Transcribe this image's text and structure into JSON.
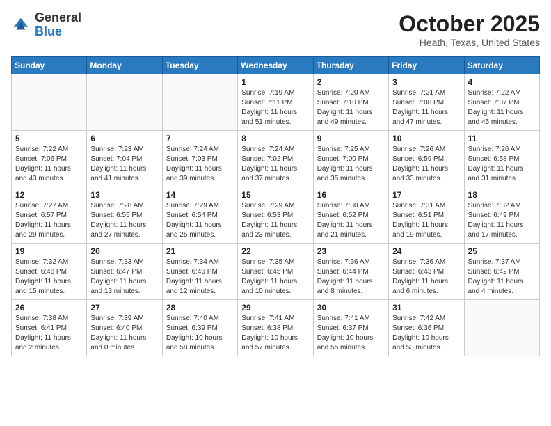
{
  "header": {
    "logo_general": "General",
    "logo_blue": "Blue",
    "month": "October 2025",
    "location": "Heath, Texas, United States"
  },
  "weekdays": [
    "Sunday",
    "Monday",
    "Tuesday",
    "Wednesday",
    "Thursday",
    "Friday",
    "Saturday"
  ],
  "weeks": [
    [
      {
        "day": "",
        "empty": true
      },
      {
        "day": "",
        "empty": true
      },
      {
        "day": "",
        "empty": true
      },
      {
        "day": "1",
        "rise": "7:19 AM",
        "set": "7:11 PM",
        "daylight": "11 hours and 51 minutes."
      },
      {
        "day": "2",
        "rise": "7:20 AM",
        "set": "7:10 PM",
        "daylight": "11 hours and 49 minutes."
      },
      {
        "day": "3",
        "rise": "7:21 AM",
        "set": "7:08 PM",
        "daylight": "11 hours and 47 minutes."
      },
      {
        "day": "4",
        "rise": "7:22 AM",
        "set": "7:07 PM",
        "daylight": "11 hours and 45 minutes."
      }
    ],
    [
      {
        "day": "5",
        "rise": "7:22 AM",
        "set": "7:06 PM",
        "daylight": "11 hours and 43 minutes."
      },
      {
        "day": "6",
        "rise": "7:23 AM",
        "set": "7:04 PM",
        "daylight": "11 hours and 41 minutes."
      },
      {
        "day": "7",
        "rise": "7:24 AM",
        "set": "7:03 PM",
        "daylight": "11 hours and 39 minutes."
      },
      {
        "day": "8",
        "rise": "7:24 AM",
        "set": "7:02 PM",
        "daylight": "11 hours and 37 minutes."
      },
      {
        "day": "9",
        "rise": "7:25 AM",
        "set": "7:00 PM",
        "daylight": "11 hours and 35 minutes."
      },
      {
        "day": "10",
        "rise": "7:26 AM",
        "set": "6:59 PM",
        "daylight": "11 hours and 33 minutes."
      },
      {
        "day": "11",
        "rise": "7:26 AM",
        "set": "6:58 PM",
        "daylight": "11 hours and 31 minutes."
      }
    ],
    [
      {
        "day": "12",
        "rise": "7:27 AM",
        "set": "6:57 PM",
        "daylight": "11 hours and 29 minutes."
      },
      {
        "day": "13",
        "rise": "7:28 AM",
        "set": "6:55 PM",
        "daylight": "11 hours and 27 minutes."
      },
      {
        "day": "14",
        "rise": "7:29 AM",
        "set": "6:54 PM",
        "daylight": "11 hours and 25 minutes."
      },
      {
        "day": "15",
        "rise": "7:29 AM",
        "set": "6:53 PM",
        "daylight": "11 hours and 23 minutes."
      },
      {
        "day": "16",
        "rise": "7:30 AM",
        "set": "6:52 PM",
        "daylight": "11 hours and 21 minutes."
      },
      {
        "day": "17",
        "rise": "7:31 AM",
        "set": "6:51 PM",
        "daylight": "11 hours and 19 minutes."
      },
      {
        "day": "18",
        "rise": "7:32 AM",
        "set": "6:49 PM",
        "daylight": "11 hours and 17 minutes."
      }
    ],
    [
      {
        "day": "19",
        "rise": "7:32 AM",
        "set": "6:48 PM",
        "daylight": "11 hours and 15 minutes."
      },
      {
        "day": "20",
        "rise": "7:33 AM",
        "set": "6:47 PM",
        "daylight": "11 hours and 13 minutes."
      },
      {
        "day": "21",
        "rise": "7:34 AM",
        "set": "6:46 PM",
        "daylight": "11 hours and 12 minutes."
      },
      {
        "day": "22",
        "rise": "7:35 AM",
        "set": "6:45 PM",
        "daylight": "11 hours and 10 minutes."
      },
      {
        "day": "23",
        "rise": "7:36 AM",
        "set": "6:44 PM",
        "daylight": "11 hours and 8 minutes."
      },
      {
        "day": "24",
        "rise": "7:36 AM",
        "set": "6:43 PM",
        "daylight": "11 hours and 6 minutes."
      },
      {
        "day": "25",
        "rise": "7:37 AM",
        "set": "6:42 PM",
        "daylight": "11 hours and 4 minutes."
      }
    ],
    [
      {
        "day": "26",
        "rise": "7:38 AM",
        "set": "6:41 PM",
        "daylight": "11 hours and 2 minutes."
      },
      {
        "day": "27",
        "rise": "7:39 AM",
        "set": "6:40 PM",
        "daylight": "11 hours and 0 minutes."
      },
      {
        "day": "28",
        "rise": "7:40 AM",
        "set": "6:39 PM",
        "daylight": "10 hours and 58 minutes."
      },
      {
        "day": "29",
        "rise": "7:41 AM",
        "set": "6:38 PM",
        "daylight": "10 hours and 57 minutes."
      },
      {
        "day": "30",
        "rise": "7:41 AM",
        "set": "6:37 PM",
        "daylight": "10 hours and 55 minutes."
      },
      {
        "day": "31",
        "rise": "7:42 AM",
        "set": "6:36 PM",
        "daylight": "10 hours and 53 minutes."
      },
      {
        "day": "",
        "empty": true
      }
    ]
  ]
}
